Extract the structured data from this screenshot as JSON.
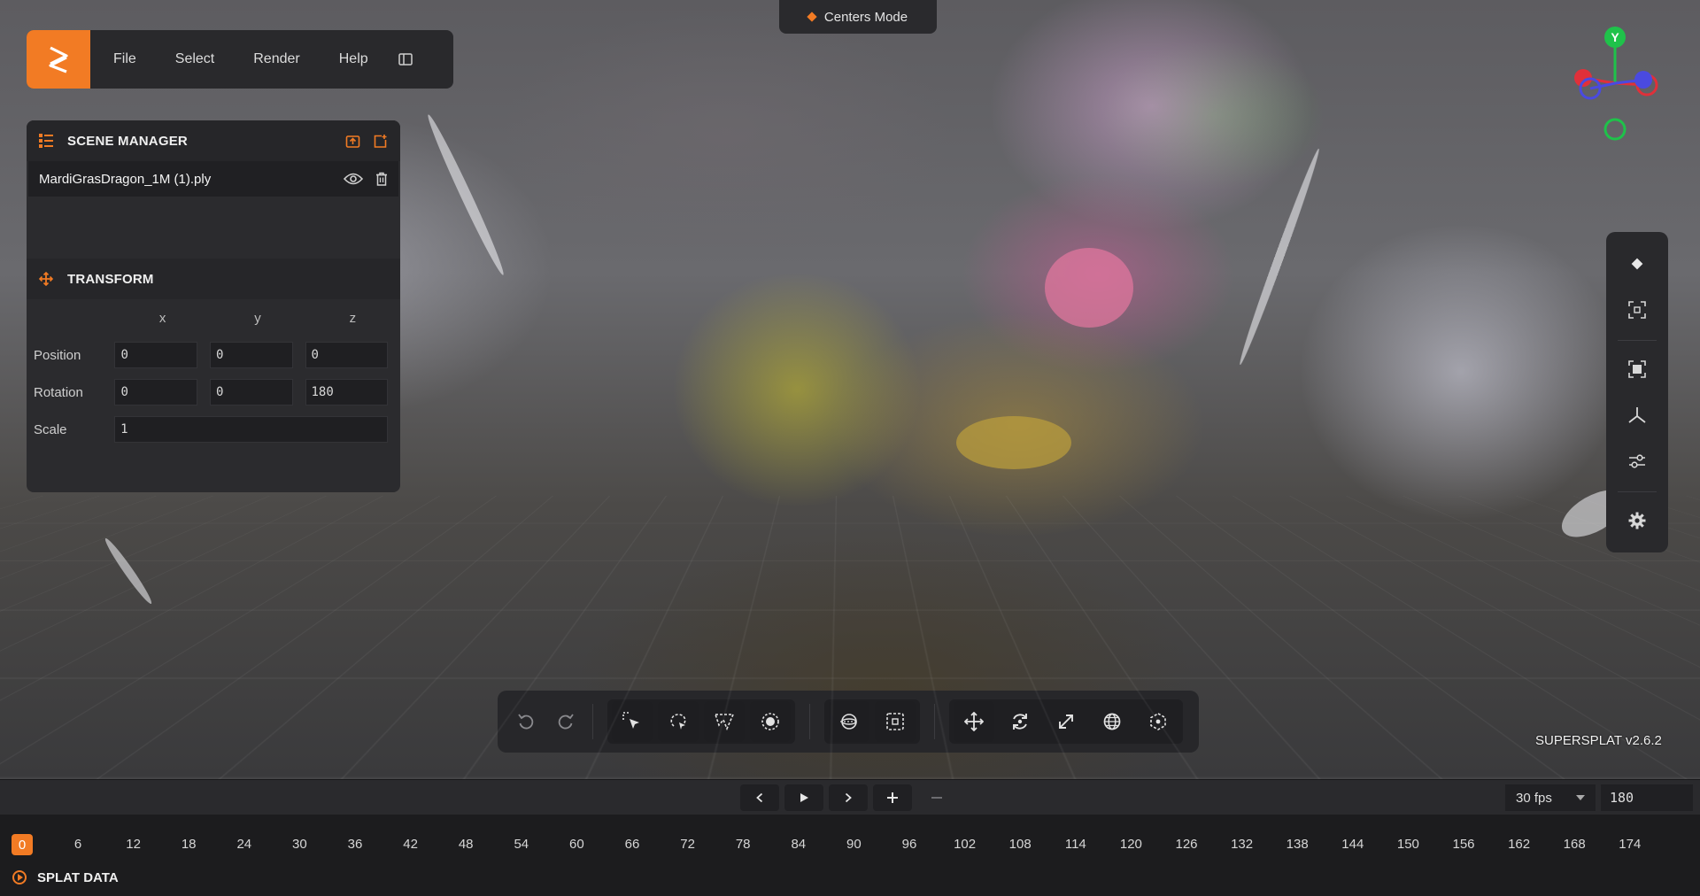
{
  "mode_pill": {
    "label": "Centers Mode",
    "icon": "diamond-icon"
  },
  "menu": {
    "logo": "supersplat-logo",
    "items": [
      "File",
      "Select",
      "Render",
      "Help"
    ],
    "toggle_icon": "panel-toggle-icon"
  },
  "scene_manager": {
    "title": "SCENE MANAGER",
    "header_actions": [
      "import-icon",
      "new-scene-icon"
    ],
    "items": [
      {
        "name": "MardiGrasDragon_1M (1).ply",
        "icons": [
          "eye-icon",
          "trash-icon"
        ]
      }
    ]
  },
  "transform": {
    "title": "TRANSFORM",
    "columns": [
      "x",
      "y",
      "z"
    ],
    "position": {
      "label": "Position",
      "x": "0",
      "y": "0",
      "z": "0"
    },
    "rotation": {
      "label": "Rotation",
      "x": "0",
      "y": "0",
      "z": "180"
    },
    "scale": {
      "label": "Scale",
      "value": "1"
    }
  },
  "gizmo": {
    "y_label": "Y"
  },
  "right_toolbar": [
    "diamond-icon",
    "frame-selection-icon",
    "reset-camera-icon",
    "axes-icon",
    "sliders-icon",
    "settings-icon"
  ],
  "bottom_toolbar": {
    "groups": [
      [
        "undo-icon",
        "redo-icon"
      ],
      [
        "picker-icon",
        "lasso-icon",
        "polygon-select-icon",
        "brush-select-icon"
      ],
      [
        "sphere-select-icon",
        "box-select-icon"
      ],
      [
        "move-icon",
        "rotate-icon",
        "scale-icon",
        "world-space-icon",
        "origin-icon"
      ]
    ]
  },
  "version": "SUPERSPLAT v2.6.2",
  "timeline": {
    "controls": [
      "prev-frame-icon",
      "play-icon",
      "next-frame-icon",
      "add-key-icon",
      "remove-key-icon"
    ],
    "fps": "30 fps",
    "frames": "180",
    "current_frame": "0",
    "ticks": [
      "6",
      "12",
      "18",
      "24",
      "30",
      "36",
      "42",
      "48",
      "54",
      "60",
      "66",
      "72",
      "78",
      "84",
      "90",
      "96",
      "102",
      "108",
      "114",
      "120",
      "126",
      "132",
      "138",
      "144",
      "150",
      "156",
      "162",
      "168",
      "174"
    ]
  },
  "status": {
    "label": "SPLAT DATA",
    "icon": "play-circle-icon"
  },
  "colors": {
    "accent": "#f27b24",
    "panel": "#2b2b2e",
    "axis_y": "#1fc24a",
    "axis_x": "#e0303a",
    "axis_z": "#4a4ae0"
  }
}
